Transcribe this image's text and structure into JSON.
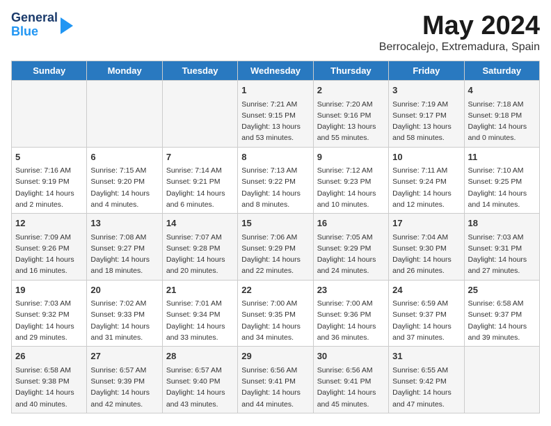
{
  "header": {
    "logo_line1": "General",
    "logo_line2": "Blue",
    "month": "May 2024",
    "location": "Berrocalejo, Extremadura, Spain"
  },
  "weekdays": [
    "Sunday",
    "Monday",
    "Tuesday",
    "Wednesday",
    "Thursday",
    "Friday",
    "Saturday"
  ],
  "weeks": [
    [
      {
        "day": "",
        "info": ""
      },
      {
        "day": "",
        "info": ""
      },
      {
        "day": "",
        "info": ""
      },
      {
        "day": "1",
        "info": "Sunrise: 7:21 AM\nSunset: 9:15 PM\nDaylight: 13 hours\nand 53 minutes."
      },
      {
        "day": "2",
        "info": "Sunrise: 7:20 AM\nSunset: 9:16 PM\nDaylight: 13 hours\nand 55 minutes."
      },
      {
        "day": "3",
        "info": "Sunrise: 7:19 AM\nSunset: 9:17 PM\nDaylight: 13 hours\nand 58 minutes."
      },
      {
        "day": "4",
        "info": "Sunrise: 7:18 AM\nSunset: 9:18 PM\nDaylight: 14 hours\nand 0 minutes."
      }
    ],
    [
      {
        "day": "5",
        "info": "Sunrise: 7:16 AM\nSunset: 9:19 PM\nDaylight: 14 hours\nand 2 minutes."
      },
      {
        "day": "6",
        "info": "Sunrise: 7:15 AM\nSunset: 9:20 PM\nDaylight: 14 hours\nand 4 minutes."
      },
      {
        "day": "7",
        "info": "Sunrise: 7:14 AM\nSunset: 9:21 PM\nDaylight: 14 hours\nand 6 minutes."
      },
      {
        "day": "8",
        "info": "Sunrise: 7:13 AM\nSunset: 9:22 PM\nDaylight: 14 hours\nand 8 minutes."
      },
      {
        "day": "9",
        "info": "Sunrise: 7:12 AM\nSunset: 9:23 PM\nDaylight: 14 hours\nand 10 minutes."
      },
      {
        "day": "10",
        "info": "Sunrise: 7:11 AM\nSunset: 9:24 PM\nDaylight: 14 hours\nand 12 minutes."
      },
      {
        "day": "11",
        "info": "Sunrise: 7:10 AM\nSunset: 9:25 PM\nDaylight: 14 hours\nand 14 minutes."
      }
    ],
    [
      {
        "day": "12",
        "info": "Sunrise: 7:09 AM\nSunset: 9:26 PM\nDaylight: 14 hours\nand 16 minutes."
      },
      {
        "day": "13",
        "info": "Sunrise: 7:08 AM\nSunset: 9:27 PM\nDaylight: 14 hours\nand 18 minutes."
      },
      {
        "day": "14",
        "info": "Sunrise: 7:07 AM\nSunset: 9:28 PM\nDaylight: 14 hours\nand 20 minutes."
      },
      {
        "day": "15",
        "info": "Sunrise: 7:06 AM\nSunset: 9:29 PM\nDaylight: 14 hours\nand 22 minutes."
      },
      {
        "day": "16",
        "info": "Sunrise: 7:05 AM\nSunset: 9:29 PM\nDaylight: 14 hours\nand 24 minutes."
      },
      {
        "day": "17",
        "info": "Sunrise: 7:04 AM\nSunset: 9:30 PM\nDaylight: 14 hours\nand 26 minutes."
      },
      {
        "day": "18",
        "info": "Sunrise: 7:03 AM\nSunset: 9:31 PM\nDaylight: 14 hours\nand 27 minutes."
      }
    ],
    [
      {
        "day": "19",
        "info": "Sunrise: 7:03 AM\nSunset: 9:32 PM\nDaylight: 14 hours\nand 29 minutes."
      },
      {
        "day": "20",
        "info": "Sunrise: 7:02 AM\nSunset: 9:33 PM\nDaylight: 14 hours\nand 31 minutes."
      },
      {
        "day": "21",
        "info": "Sunrise: 7:01 AM\nSunset: 9:34 PM\nDaylight: 14 hours\nand 33 minutes."
      },
      {
        "day": "22",
        "info": "Sunrise: 7:00 AM\nSunset: 9:35 PM\nDaylight: 14 hours\nand 34 minutes."
      },
      {
        "day": "23",
        "info": "Sunrise: 7:00 AM\nSunset: 9:36 PM\nDaylight: 14 hours\nand 36 minutes."
      },
      {
        "day": "24",
        "info": "Sunrise: 6:59 AM\nSunset: 9:37 PM\nDaylight: 14 hours\nand 37 minutes."
      },
      {
        "day": "25",
        "info": "Sunrise: 6:58 AM\nSunset: 9:37 PM\nDaylight: 14 hours\nand 39 minutes."
      }
    ],
    [
      {
        "day": "26",
        "info": "Sunrise: 6:58 AM\nSunset: 9:38 PM\nDaylight: 14 hours\nand 40 minutes."
      },
      {
        "day": "27",
        "info": "Sunrise: 6:57 AM\nSunset: 9:39 PM\nDaylight: 14 hours\nand 42 minutes."
      },
      {
        "day": "28",
        "info": "Sunrise: 6:57 AM\nSunset: 9:40 PM\nDaylight: 14 hours\nand 43 minutes."
      },
      {
        "day": "29",
        "info": "Sunrise: 6:56 AM\nSunset: 9:41 PM\nDaylight: 14 hours\nand 44 minutes."
      },
      {
        "day": "30",
        "info": "Sunrise: 6:56 AM\nSunset: 9:41 PM\nDaylight: 14 hours\nand 45 minutes."
      },
      {
        "day": "31",
        "info": "Sunrise: 6:55 AM\nSunset: 9:42 PM\nDaylight: 14 hours\nand 47 minutes."
      },
      {
        "day": "",
        "info": ""
      }
    ]
  ]
}
